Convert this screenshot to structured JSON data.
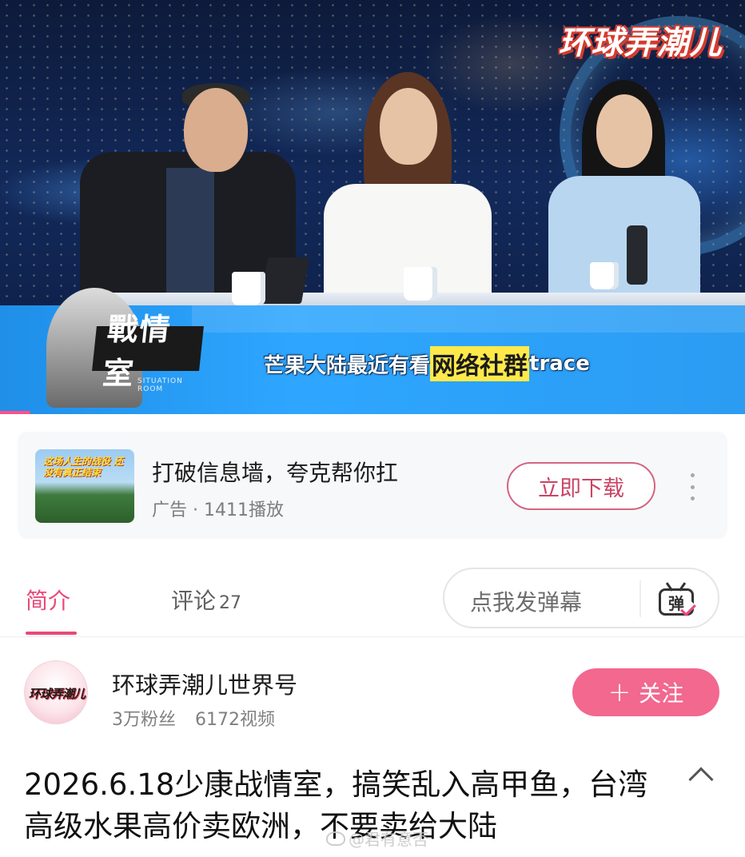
{
  "video": {
    "channel_logo_text": "环球弄潮儿",
    "show_title": "戰情室",
    "show_subtitle_en": "SITUATION ROOM",
    "subtitle_prefix": "芒果大陆最近有看",
    "subtitle_highlight": "网络社群",
    "subtitle_suffix": "trace"
  },
  "ad": {
    "thumb_text": "这场人生的战役 还没有真正结束",
    "title": "打破信息墙，夸克帮你扛",
    "meta": "广告 · 1411播放",
    "cta_label": "立即下载",
    "more_icon": "more-vertical-icon"
  },
  "tabs": {
    "intro_label": "简介",
    "comments_label": "评论",
    "comments_count": "27"
  },
  "danmaku": {
    "placeholder": "点我发弹幕",
    "icon_char": "弹"
  },
  "channel": {
    "avatar_text": "环球弄潮儿",
    "name": "环球弄潮儿世界号",
    "followers": "3万粉丝",
    "videos": "6172视频",
    "follow_label": "关注"
  },
  "title": {
    "text": "2026.6.18少康战情室，搞笑乱入高甲鱼，台湾高级水果高价卖欧洲，不要卖给大陆"
  },
  "watermark": {
    "text": "@君有意否"
  },
  "colors": {
    "accent": "#e84a78",
    "follow_bg": "#f2688f",
    "subtitle_highlight_bg": "#ffe94a",
    "lower_bar": "#2ea6ff"
  }
}
